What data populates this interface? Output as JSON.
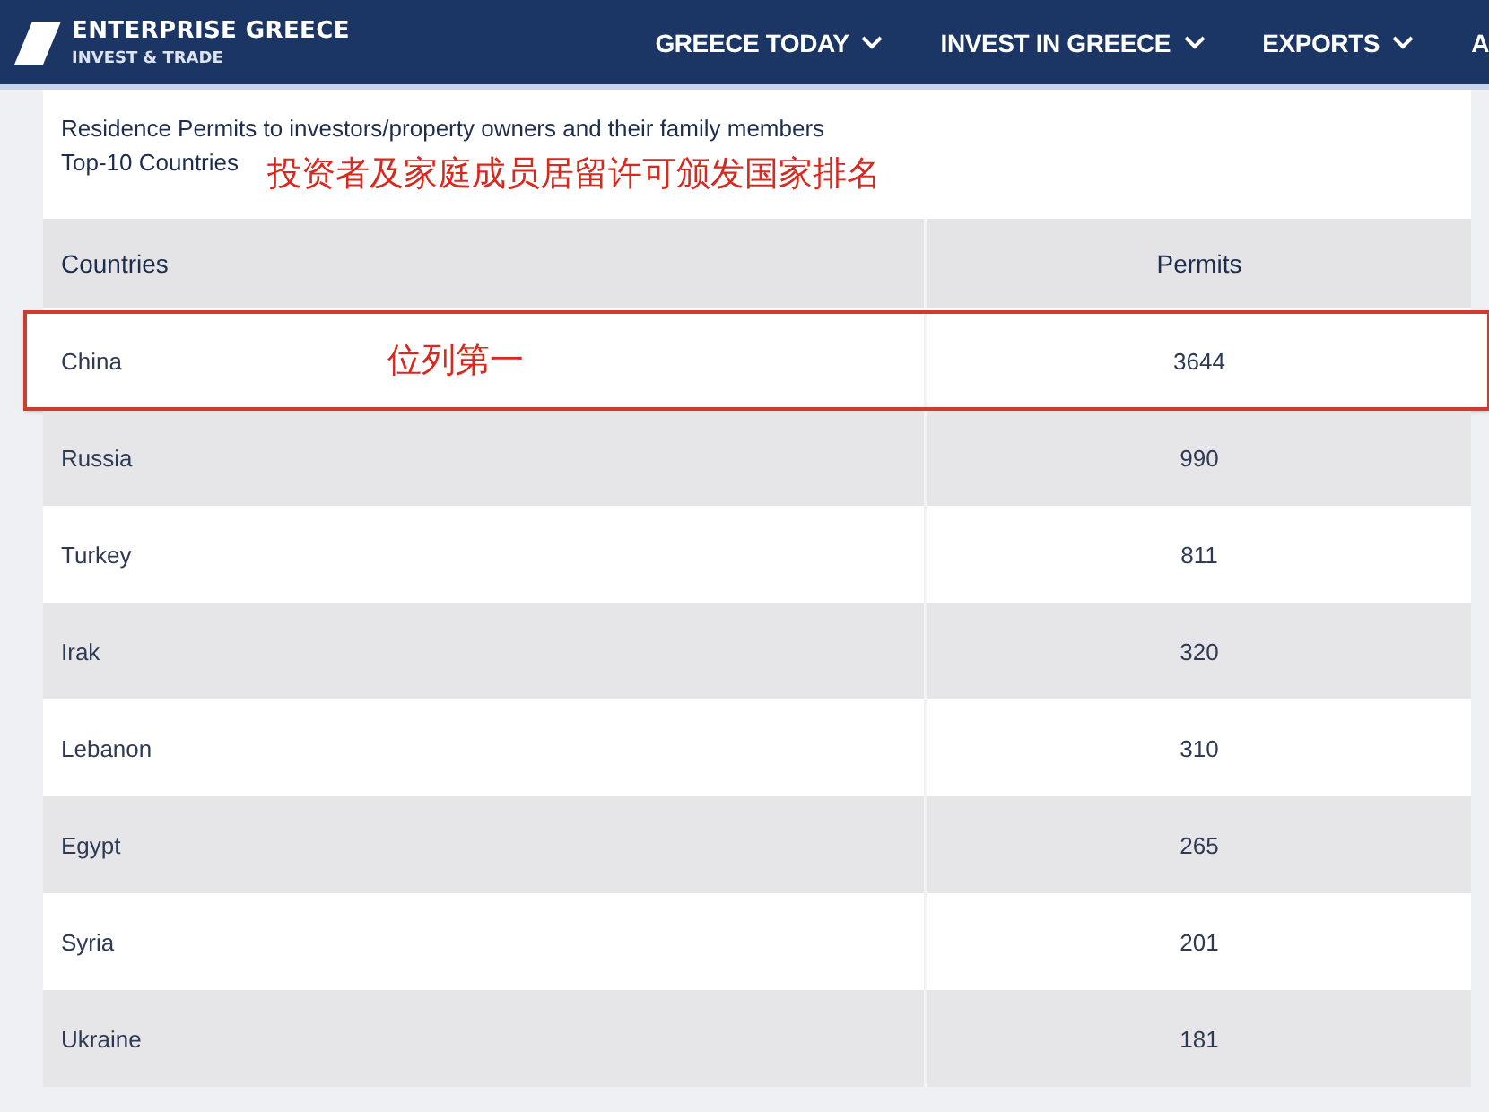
{
  "header": {
    "brand": "ENTERPRISE GREECE",
    "tagline": "INVEST & TRADE",
    "nav": [
      {
        "label": "GREECE TODAY",
        "caret": true
      },
      {
        "label": "INVEST IN GREECE",
        "caret": true
      },
      {
        "label": "EXPORTS",
        "caret": true
      },
      {
        "label": "A",
        "caret": false
      }
    ]
  },
  "section": {
    "title": "Residence Permits to investors/property owners and their family members",
    "subtitle": "Top-10 Countries",
    "caption": "投资者及家庭成员居留许可颁发国家排名"
  },
  "table": {
    "columns": [
      "Countries",
      "Permits"
    ],
    "rows": [
      {
        "country": "China",
        "permits": "3644",
        "highlighted": true,
        "note": "位列第一"
      },
      {
        "country": "Russia",
        "permits": "990",
        "highlighted": false
      },
      {
        "country": "Turkey",
        "permits": "811",
        "highlighted": false
      },
      {
        "country": "Irak",
        "permits": "320",
        "highlighted": false
      },
      {
        "country": "Lebanon",
        "permits": "310",
        "highlighted": false
      },
      {
        "country": "Egypt",
        "permits": "265",
        "highlighted": false
      },
      {
        "country": "Syria",
        "permits": "201",
        "highlighted": false
      },
      {
        "country": "Ukraine",
        "permits": "181",
        "highlighted": false
      }
    ]
  }
}
